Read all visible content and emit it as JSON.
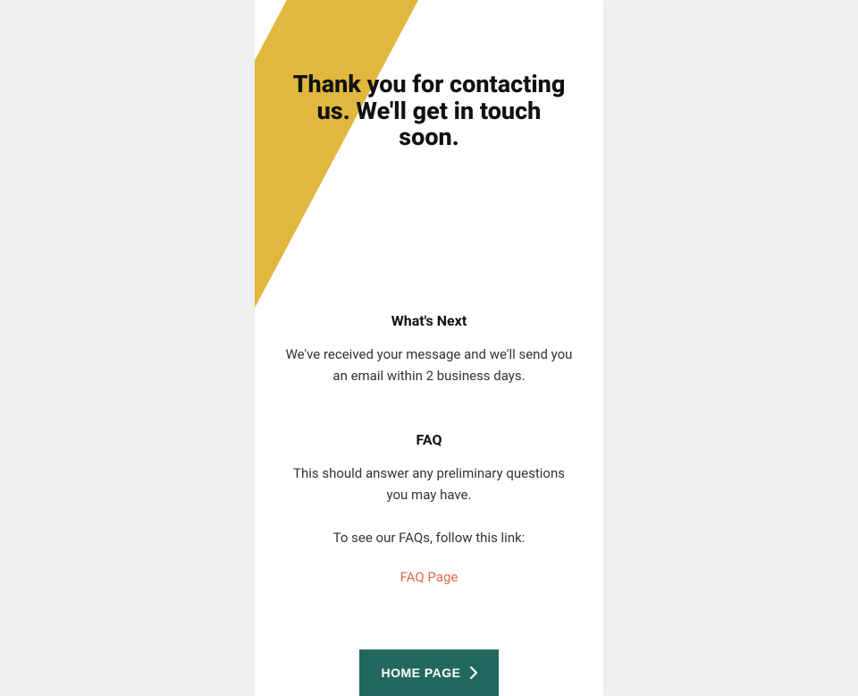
{
  "colors": {
    "accent_stripe": "#e2b73e",
    "button_bg": "#23685f",
    "link": "#dd6b4d"
  },
  "headline": "Thank you for contacting us. We'll get in touch soon.",
  "whatsNext": {
    "title": "What's Next",
    "body": "We've received your message and we'll send you an email within 2 business days."
  },
  "faq": {
    "title": "FAQ",
    "body": "This should answer any preliminary questions you may have.",
    "lead": "To see our FAQs, follow this link:",
    "link_text": "FAQ Page"
  },
  "button": {
    "label": "HOME PAGE"
  }
}
